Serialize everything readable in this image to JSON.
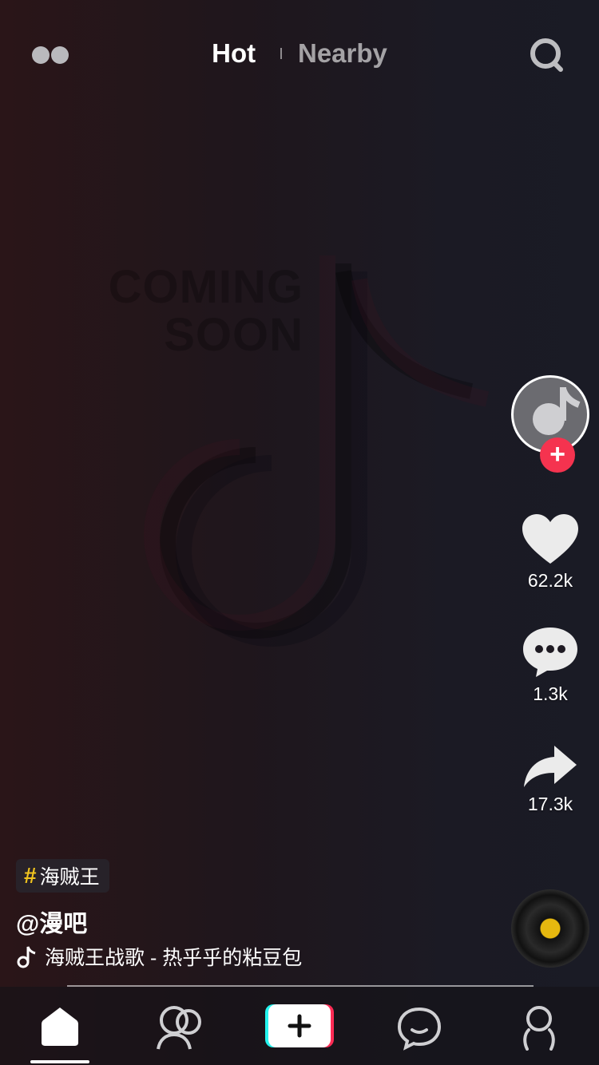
{
  "header": {
    "tabs": [
      {
        "label": "Hot",
        "active": true
      },
      {
        "label": "Nearby",
        "active": false
      }
    ],
    "icons": {
      "left": "live-dots-icon",
      "right": "search-icon"
    }
  },
  "background": {
    "watermark_text_line1": "COMING",
    "watermark_text_line2": "SOON"
  },
  "rail": {
    "follow_symbol": "+",
    "like_count": "62.2k",
    "comment_count": "1.3k",
    "share_count": "17.3k"
  },
  "caption": {
    "hashtag_symbol": "#",
    "hashtag": "海贼王",
    "username": "@漫吧",
    "song": "海贼王战歌 - 热乎乎的粘豆包"
  },
  "bottom_nav": {
    "items": [
      "home-icon",
      "friends-icon",
      "create-icon",
      "messages-icon",
      "profile-icon"
    ]
  },
  "colors": {
    "accent_red": "#f5334f",
    "hashtag_yellow": "#f0c31e",
    "tiktok_cyan": "#25f4ee"
  }
}
